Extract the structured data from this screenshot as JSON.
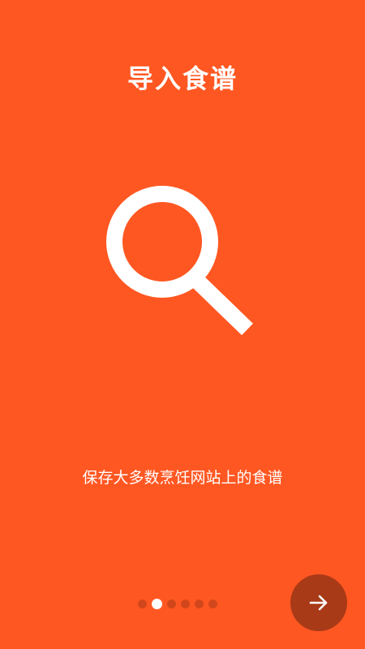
{
  "onboarding": {
    "title": "导入食谱",
    "subtitle": "保存大多数烹饪网站上的食谱",
    "hero_icon": "search-icon",
    "page_indicator": {
      "total": 6,
      "current": 2
    },
    "next_button_icon": "arrow-right-icon"
  },
  "colors": {
    "background": "#FF5722",
    "next_button": "#A83A17",
    "text": "#FFFFFF"
  }
}
